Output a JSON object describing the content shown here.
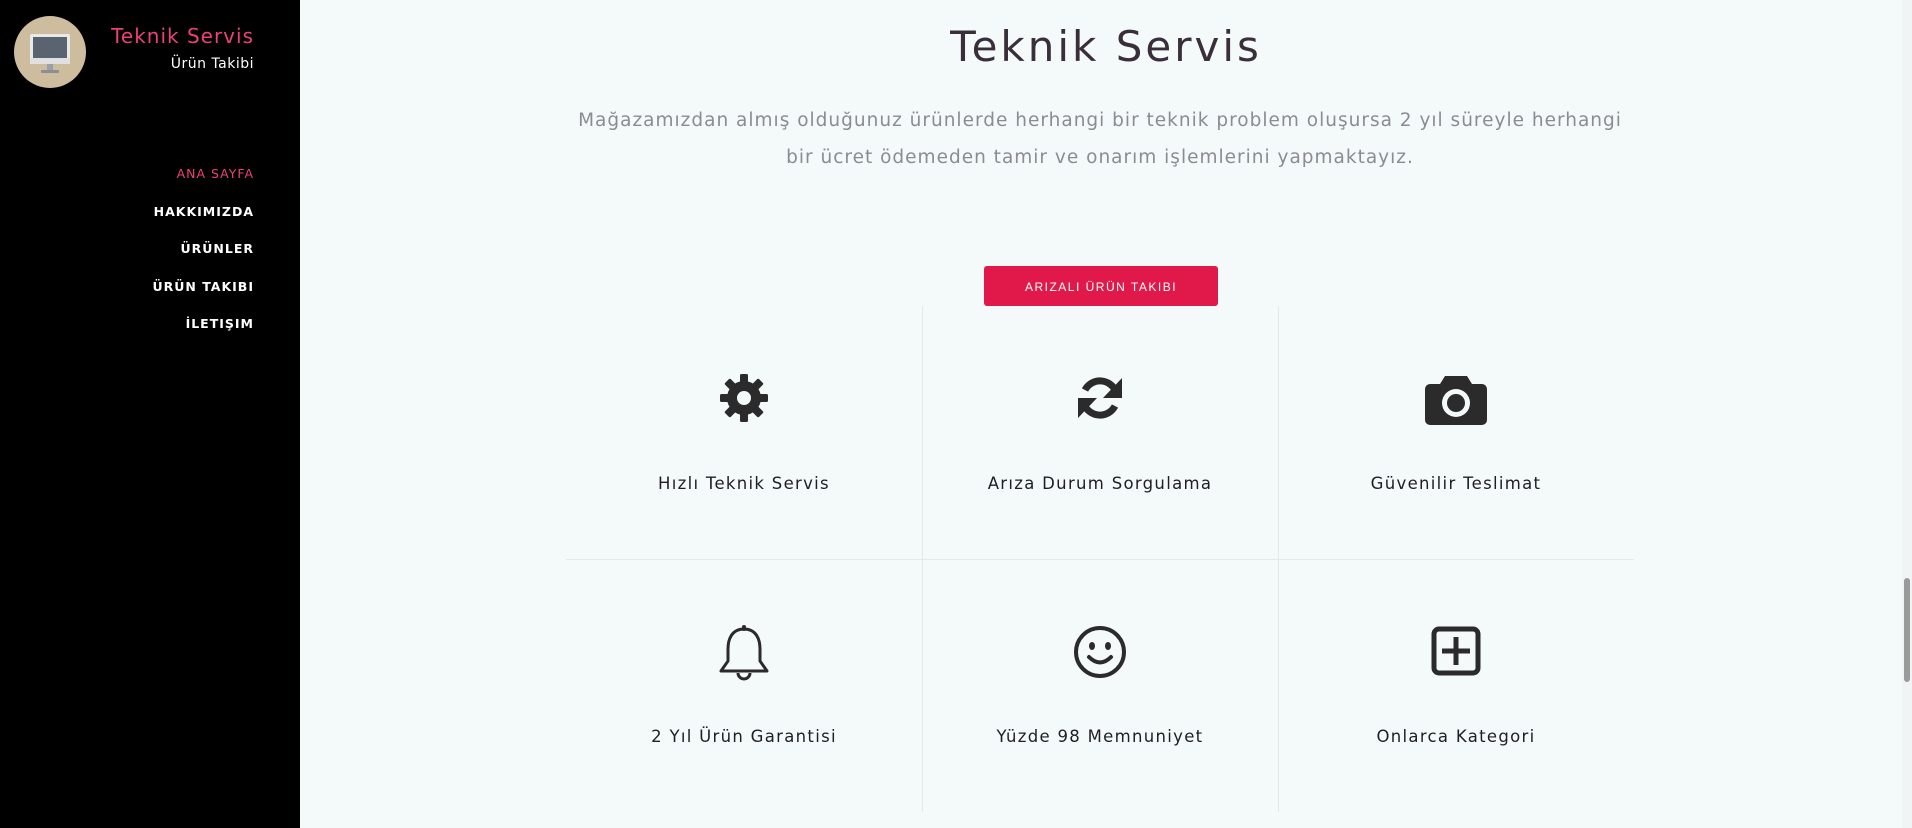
{
  "brand": {
    "title": "Teknik Servis",
    "subtitle": "Ürün Takibi",
    "logo_icon": "monitor-icon",
    "accent": "#ec407a"
  },
  "nav": {
    "items": [
      {
        "label": "ANA SAYFA",
        "active": true
      },
      {
        "label": "HAKKIMIZDA",
        "active": false
      },
      {
        "label": "ÜRÜNLER",
        "active": false
      },
      {
        "label": "ÜRÜN TAKIBI",
        "active": false
      },
      {
        "label": "İLETIŞIM",
        "active": false
      }
    ]
  },
  "main": {
    "title": "Teknik Servis",
    "intro": "Mağazamızdan almış olduğunuz ürünlerde herhangi bir teknik problem oluşursa 2 yıl süreyle herhangi bir ücret ödemeden tamir ve onarım işlemlerini yapmaktayız.",
    "cta_label": "ARIZALI ÜRÜN TAKIBI",
    "cta_color": "#e0194a",
    "features": [
      {
        "icon": "gear-icon",
        "label": "Hızlı Teknik Servis"
      },
      {
        "icon": "refresh-icon",
        "label": "Arıza Durum Sorgulama"
      },
      {
        "icon": "camera-icon",
        "label": "Güvenilir Teslimat"
      },
      {
        "icon": "bell-icon",
        "label": "2 Yıl Ürün Garantisi"
      },
      {
        "icon": "smile-icon",
        "label": "Yüzde 98 Memnuniyet"
      },
      {
        "icon": "plus-square-icon",
        "label": "Onlarca Kategori"
      }
    ]
  }
}
